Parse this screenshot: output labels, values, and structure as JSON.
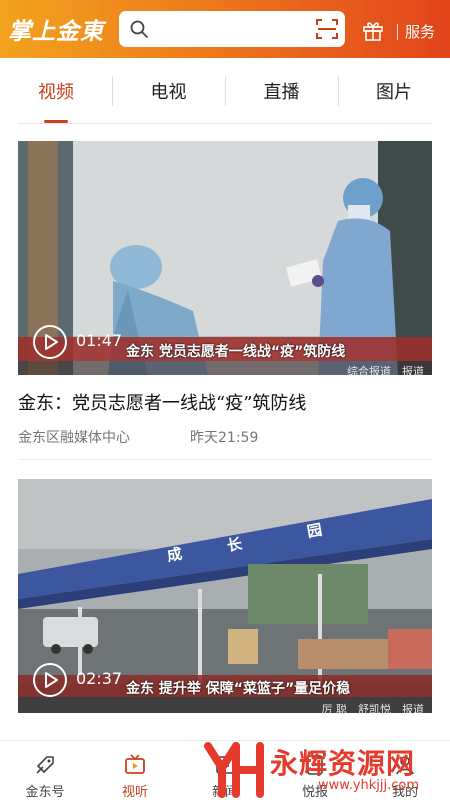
{
  "header": {
    "logo": "掌上金東",
    "service_label": "服务",
    "search_icon": "search-icon",
    "scan_icon": "scan-icon",
    "gift_icon": "gift-icon",
    "brand_color": "#ed7a1b"
  },
  "tabs": [
    {
      "label": "视频",
      "active": true
    },
    {
      "label": "电视",
      "active": false
    },
    {
      "label": "直播",
      "active": false
    },
    {
      "label": "图片",
      "active": false
    }
  ],
  "videos": [
    {
      "duration": "01:47",
      "caption": "金东 党员志愿者一线战“疫”筑防线",
      "credit": "综合报道　报道",
      "title": "金东：党员志愿者一线战“疫”筑防线",
      "source": "金东区融媒体中心",
      "time": "昨天21:59"
    },
    {
      "duration": "02:37",
      "caption": "金东 提升举 保障“菜篮子”量足价稳",
      "credit": "厉 聪　舒凯悦　报道",
      "sign_text": "成 长 园"
    }
  ],
  "bottom_nav": [
    {
      "label": "金东号",
      "icon": "rocket-tag-icon",
      "active": false
    },
    {
      "label": "视听",
      "icon": "tv-icon",
      "active": true
    },
    {
      "label": "新闻",
      "icon": "news-icon",
      "active": false
    },
    {
      "label": "悦报",
      "icon": "report-icon",
      "active": false
    },
    {
      "label": "我的",
      "icon": "user-icon",
      "active": false
    }
  ],
  "watermark": {
    "text": "永辉资源网",
    "url": "www.yhkjjj.com"
  },
  "accent_color": "#c8411d"
}
